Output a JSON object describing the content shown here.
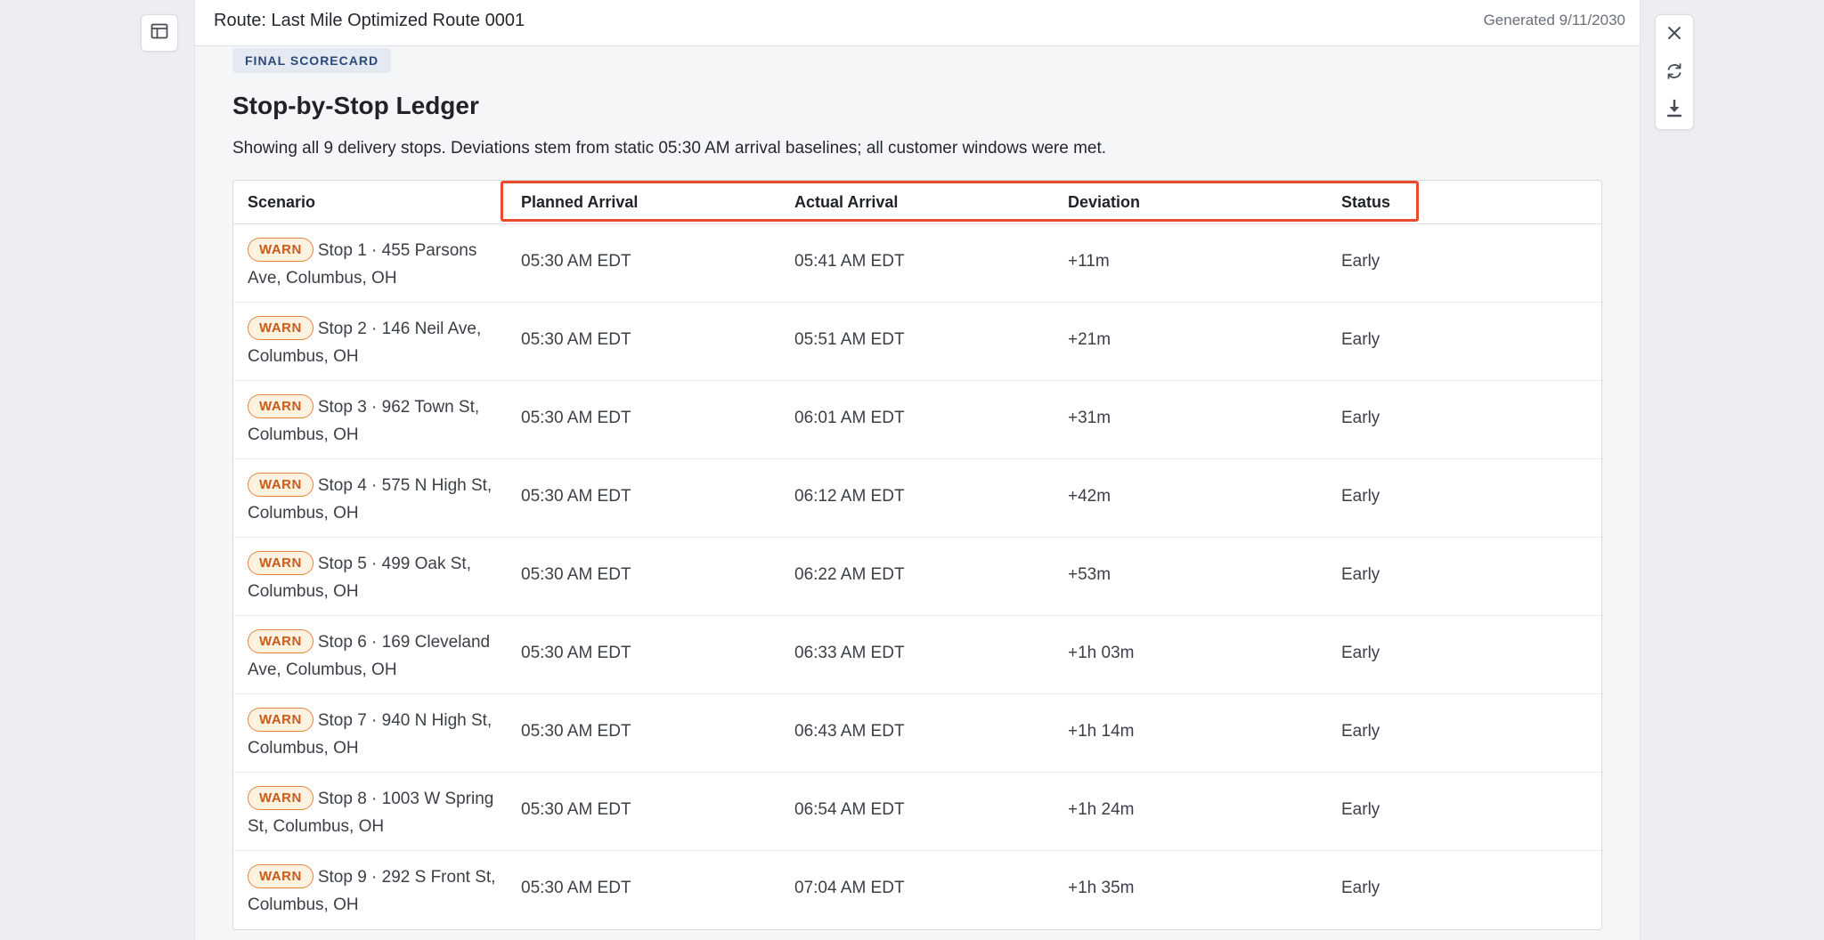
{
  "header": {
    "title": "Route: Last Mile Optimized Route 0001",
    "generated": "Generated 9/11/2030"
  },
  "badge": "FINAL SCORECARD",
  "ledger": {
    "title": "Stop-by-Stop Ledger",
    "description": "Showing all 9 delivery stops. Deviations stem from static 05:30 AM arrival baselines; all customer windows were met."
  },
  "table": {
    "columns": [
      "Scenario",
      "Planned Arrival",
      "Actual Arrival",
      "Deviation",
      "Status"
    ],
    "rows": [
      {
        "tag": "WARN",
        "scenario": "Stop 1 · 455 Parsons Ave, Columbus, OH",
        "planned": "05:30 AM EDT",
        "actual": "05:41 AM EDT",
        "deviation": "+11m",
        "status": "Early"
      },
      {
        "tag": "WARN",
        "scenario": "Stop 2 · 146 Neil Ave, Columbus, OH",
        "planned": "05:30 AM EDT",
        "actual": "05:51 AM EDT",
        "deviation": "+21m",
        "status": "Early"
      },
      {
        "tag": "WARN",
        "scenario": "Stop 3 · 962 Town St, Columbus, OH",
        "planned": "05:30 AM EDT",
        "actual": "06:01 AM EDT",
        "deviation": "+31m",
        "status": "Early"
      },
      {
        "tag": "WARN",
        "scenario": "Stop 4 · 575 N High St, Columbus, OH",
        "planned": "05:30 AM EDT",
        "actual": "06:12 AM EDT",
        "deviation": "+42m",
        "status": "Early"
      },
      {
        "tag": "WARN",
        "scenario": "Stop 5 · 499 Oak St, Columbus, OH",
        "planned": "05:30 AM EDT",
        "actual": "06:22 AM EDT",
        "deviation": "+53m",
        "status": "Early"
      },
      {
        "tag": "WARN",
        "scenario": "Stop 6 · 169 Cleveland Ave, Columbus, OH",
        "planned": "05:30 AM EDT",
        "actual": "06:33 AM EDT",
        "deviation": "+1h 03m",
        "status": "Early"
      },
      {
        "tag": "WARN",
        "scenario": "Stop 7 · 940 N High St, Columbus, OH",
        "planned": "05:30 AM EDT",
        "actual": "06:43 AM EDT",
        "deviation": "+1h 14m",
        "status": "Early"
      },
      {
        "tag": "WARN",
        "scenario": "Stop 8 · 1003 W Spring St, Columbus, OH",
        "planned": "05:30 AM EDT",
        "actual": "06:54 AM EDT",
        "deviation": "+1h 24m",
        "status": "Early"
      },
      {
        "tag": "WARN",
        "scenario": "Stop 9 · 292 S Front St, Columbus, OH",
        "planned": "05:30 AM EDT",
        "actual": "07:04 AM EDT",
        "deviation": "+1h 35m",
        "status": "Early"
      }
    ]
  },
  "icons": {
    "left_tool": "layout-icon",
    "close": "close-icon",
    "refresh": "refresh-icon",
    "download": "download-icon"
  },
  "colors": {
    "highlight": "#e94b2b",
    "warn_border": "#e8843e",
    "warn_bg": "#fff3df",
    "warn_text": "#c85a1c",
    "badge_bg": "#e4e9f2",
    "badge_text": "#2b4a7a"
  }
}
